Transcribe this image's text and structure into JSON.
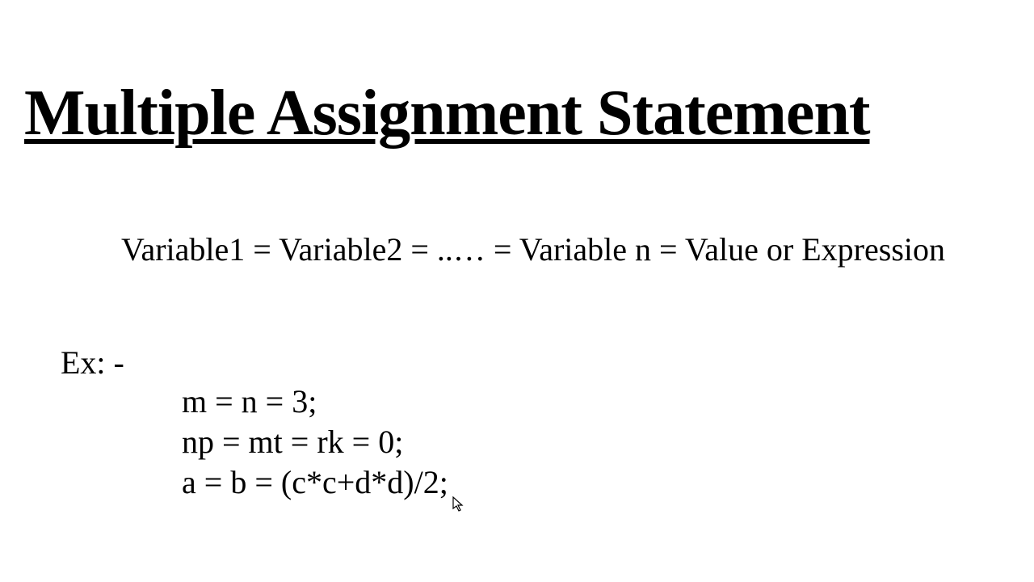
{
  "title": "Multiple Assignment Statement",
  "syntax": "Variable1 = Variable2 = ..… = Variable n = Value or Expression",
  "exampleLabel": "Ex: -",
  "examples": {
    "line1": "m = n = 3;",
    "line2": "np = mt = rk = 0;",
    "line3": "a = b = (c*c+d*d)/2;"
  }
}
